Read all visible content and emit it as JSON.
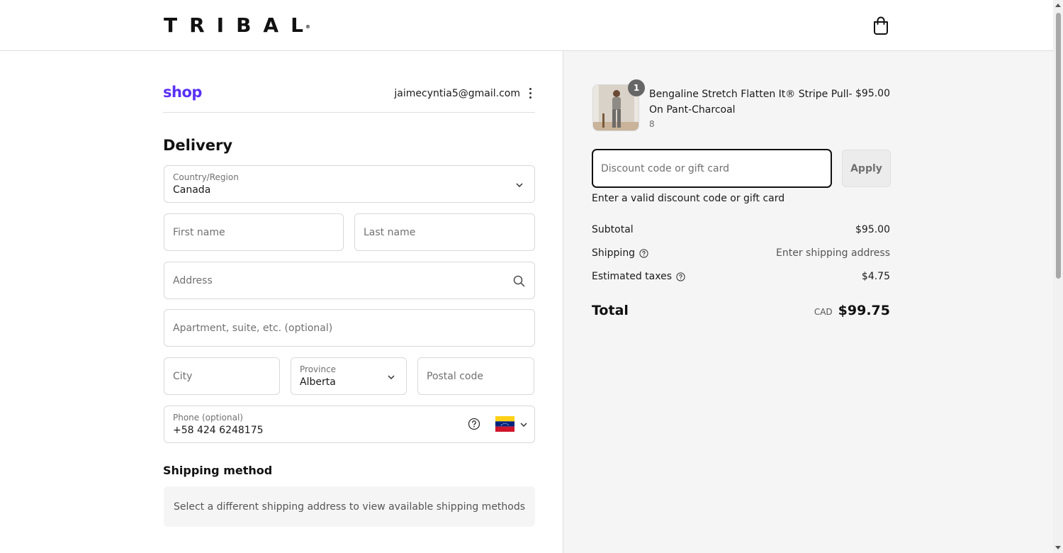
{
  "header": {
    "brand": "TRIBAL",
    "brand_mark": "®",
    "cart_icon": "shopping-bag-icon"
  },
  "account": {
    "shop_logo": "shop",
    "email": "jaimecyntia5@gmail.com",
    "menu_icon": "kebab-menu-icon"
  },
  "delivery": {
    "title": "Delivery",
    "country": {
      "label": "Country/Region",
      "value": "Canada"
    },
    "first_name": {
      "placeholder": "First name"
    },
    "last_name": {
      "placeholder": "Last name"
    },
    "address": {
      "placeholder": "Address",
      "icon": "search-icon"
    },
    "apartment": {
      "placeholder": "Apartment, suite, etc. (optional)"
    },
    "city": {
      "placeholder": "City"
    },
    "province": {
      "label": "Province",
      "value": "Alberta"
    },
    "postal_code": {
      "placeholder": "Postal code"
    },
    "phone": {
      "label": "Phone (optional)",
      "value": "+58 424 6248175",
      "flag": "venezuela-flag-icon"
    }
  },
  "shipping_method": {
    "title": "Shipping method",
    "message": "Select a different shipping address to view available shipping methods"
  },
  "order": {
    "item": {
      "quantity": "1",
      "name": "Bengaline Stretch Flatten It® Stripe Pull-On Pant-Charcoal",
      "variant": "8",
      "price": "$95.00"
    },
    "discount": {
      "placeholder": "Discount code or gift card",
      "apply_label": "Apply",
      "error": "Enter a valid discount code or gift card"
    },
    "summary": {
      "subtotal_label": "Subtotal",
      "subtotal_value": "$95.00",
      "shipping_label": "Shipping",
      "shipping_value": "Enter shipping address",
      "taxes_label": "Estimated taxes",
      "taxes_value": "$4.75",
      "total_label": "Total",
      "currency": "CAD",
      "total_value": "$99.75"
    }
  },
  "colors": {
    "shop_purple": "#5a31f4",
    "summary_bg": "#f5f5f5",
    "border": "#d9d9d9"
  }
}
